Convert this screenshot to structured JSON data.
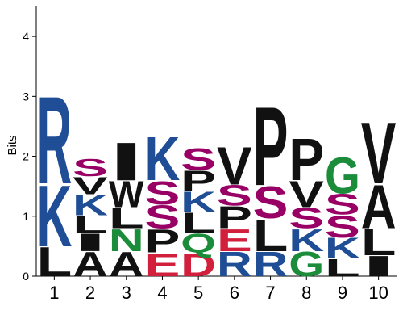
{
  "chart_data": {
    "type": "sequence-logo",
    "ylabel": "Bits",
    "ylim": [
      0,
      4.5
    ],
    "yticks": [
      0,
      1,
      2,
      3,
      4
    ],
    "colors": {
      "R": "#1f4e96",
      "K": "#1f4e96",
      "S": "#990066",
      "N": "#1a8c3a",
      "Q": "#1a8c3a",
      "G": "#1a8c3a",
      "E": "#d21f3c",
      "D": "#d21f3c",
      "A": "#111111",
      "I": "#111111",
      "L": "#111111",
      "V": "#111111",
      "W": "#111111",
      "P": "#111111"
    },
    "positions": [
      {
        "label": "1",
        "letters": [
          {
            "char": "L",
            "bits": 0.5
          },
          {
            "char": "K",
            "bits": 1.05
          },
          {
            "char": "R",
            "bits": 1.5
          }
        ]
      },
      {
        "label": "2",
        "letters": [
          {
            "char": "A",
            "bits": 0.42
          },
          {
            "char": "I",
            "bits": 0.3
          },
          {
            "char": "L",
            "bits": 0.3
          },
          {
            "char": "K",
            "bits": 0.35
          },
          {
            "char": "V",
            "bits": 0.3
          },
          {
            "char": "S",
            "bits": 0.3
          }
        ]
      },
      {
        "label": "3",
        "letters": [
          {
            "char": "A",
            "bits": 0.42
          },
          {
            "char": "N",
            "bits": 0.38
          },
          {
            "char": "L",
            "bits": 0.35
          },
          {
            "char": "W",
            "bits": 0.45
          },
          {
            "char": "I",
            "bits": 0.65
          }
        ]
      },
      {
        "label": "4",
        "letters": [
          {
            "char": "E",
            "bits": 0.4
          },
          {
            "char": "D",
            "bits": 0
          },
          {
            "char": "P",
            "bits": 0.4
          },
          {
            "char": "S",
            "bits": 0.4
          },
          {
            "char": "S",
            "bits": 0.4
          },
          {
            "char": "K",
            "bits": 0.75
          }
        ]
      },
      {
        "label": "5",
        "letters": [
          {
            "char": "D",
            "bits": 0.4
          },
          {
            "char": "Q",
            "bits": 0.32
          },
          {
            "char": "L",
            "bits": 0.35
          },
          {
            "char": "K",
            "bits": 0.35
          },
          {
            "char": "P",
            "bits": 0.35
          },
          {
            "char": "S",
            "bits": 0.38
          }
        ]
      },
      {
        "label": "6",
        "letters": [
          {
            "char": "R",
            "bits": 0.42
          },
          {
            "char": "E",
            "bits": 0.38
          },
          {
            "char": "P",
            "bits": 0.38
          },
          {
            "char": "S",
            "bits": 0.35
          },
          {
            "char": "V",
            "bits": 0.65
          }
        ]
      },
      {
        "label": "7",
        "letters": [
          {
            "char": "R",
            "bits": 0.42
          },
          {
            "char": "L",
            "bits": 0.55
          },
          {
            "char": "S",
            "bits": 0.55
          },
          {
            "char": "P",
            "bits": 1.35
          }
        ]
      },
      {
        "label": "8",
        "letters": [
          {
            "char": "G",
            "bits": 0.42
          },
          {
            "char": "K",
            "bits": 0.38
          },
          {
            "char": "S",
            "bits": 0.35
          },
          {
            "char": "V",
            "bits": 0.45
          },
          {
            "char": "P",
            "bits": 0.72
          }
        ]
      },
      {
        "label": "9",
        "letters": [
          {
            "char": "L",
            "bits": 0.3
          },
          {
            "char": "K",
            "bits": 0.35
          },
          {
            "char": "S",
            "bits": 0.38
          },
          {
            "char": "S",
            "bits": 0.35
          },
          {
            "char": "G",
            "bits": 0.62
          }
        ]
      },
      {
        "label": "10",
        "letters": [
          {
            "char": "I",
            "bits": 0.35
          },
          {
            "char": "L",
            "bits": 0.45
          },
          {
            "char": "A",
            "bits": 0.75
          },
          {
            "char": "V",
            "bits": 1.05
          }
        ]
      }
    ]
  }
}
